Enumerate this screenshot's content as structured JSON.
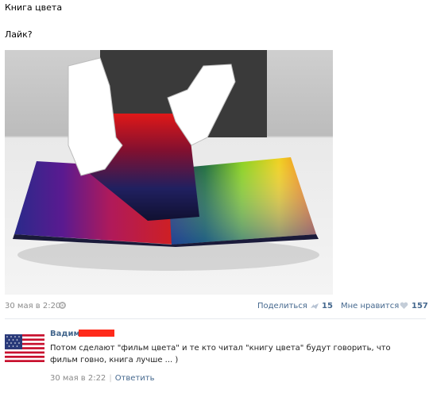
{
  "post": {
    "title": "Книга цвета",
    "text": "Лайк?",
    "date": "30 мая в 2:20",
    "share_label": "Поделиться",
    "share_count": "15",
    "like_label": "Мне нравится",
    "like_count": "157"
  },
  "comment": {
    "author": "Вадим",
    "text": "Потом сделают \"фильм цвета\" и те кто читал \"книгу цвета\" будут говорить, что фильм говно, книга лучше ... )",
    "date": "30 мая в 2:22",
    "reply_label": "Ответить"
  },
  "colors": {
    "link": "#45688e",
    "muted": "#8a8a8a",
    "redaction": "#ff2a1a"
  },
  "icons": [
    "gear-icon",
    "share-icon",
    "heart-icon",
    "us-flag-avatar"
  ]
}
